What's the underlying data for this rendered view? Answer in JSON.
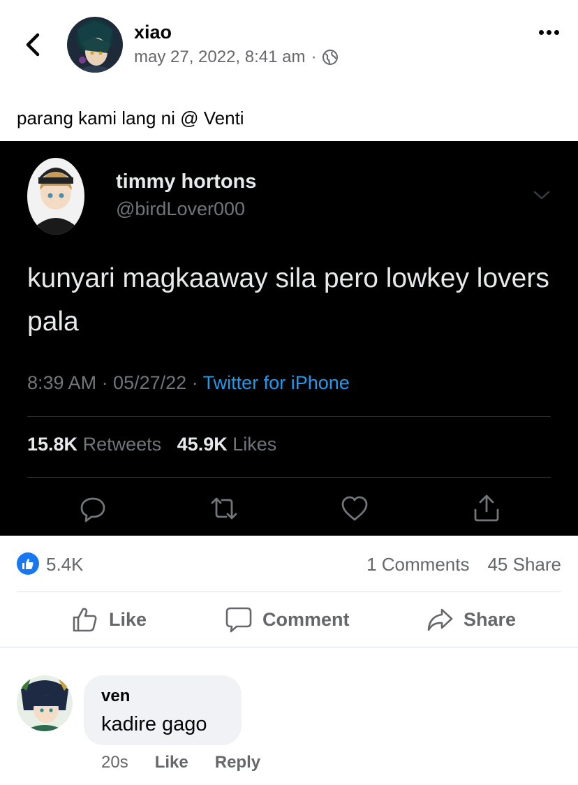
{
  "post": {
    "author": "xiao",
    "timestamp": "may 27, 2022, 8:41 am",
    "meta_separator": "·",
    "privacy_icon": "globe-icon",
    "text": "parang kami lang ni @ Venti"
  },
  "tweet": {
    "name": "timmy hortons",
    "handle": "@birdLover000",
    "body": "kunyari magkaaway sila pero lowkey lovers pala",
    "time": "8:39 AM · 05/27/22 · ",
    "source": "Twitter for iPhone",
    "retweets_count": "15.8K",
    "retweets_label": "Retweets",
    "likes_count": "45.9K",
    "likes_label": "Likes",
    "icons": [
      "reply-icon",
      "retweet-icon",
      "heart-icon",
      "share-icon"
    ]
  },
  "reactions": {
    "count": "5.4K",
    "comments": "1 Comments",
    "shares": "45 Share"
  },
  "actions": {
    "like": "Like",
    "comment": "Comment",
    "share": "Share"
  },
  "comment": {
    "author": "ven",
    "text": "kadire gago",
    "age": "20s",
    "like": "Like",
    "reply": "Reply"
  },
  "colors": {
    "facebook_blue": "#1877f2",
    "twitter_blue": "#1d9bf0",
    "tweet_background": "#000000"
  }
}
